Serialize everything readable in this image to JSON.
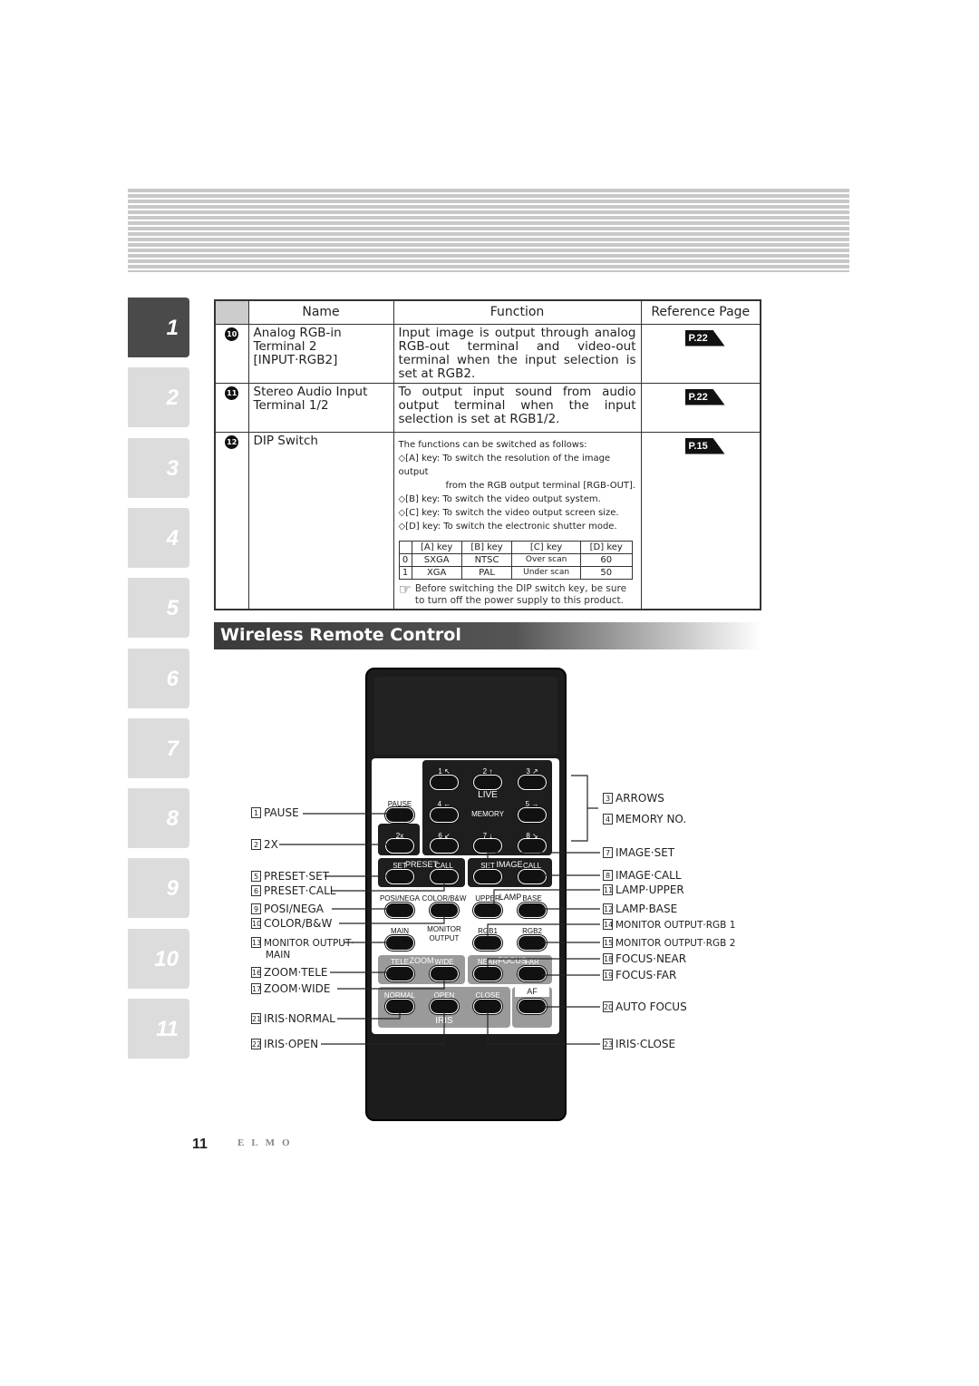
{
  "side_tabs": [
    "1",
    "2",
    "3",
    "4",
    "5",
    "6",
    "7",
    "8",
    "9",
    "10",
    "11"
  ],
  "active_tab": "1",
  "table": {
    "headers": [
      "",
      "Name",
      "Function",
      "Reference Page"
    ],
    "rows": [
      {
        "num": "10",
        "name": [
          "Analog RGB-in",
          "Terminal 2",
          "[INPUT·RGB2]"
        ],
        "function": "Input image is output through analog RGB-out terminal and video-out terminal when the input selection is set at RGB2.",
        "ref": "P.22"
      },
      {
        "num": "11",
        "name": [
          "Stereo Audio Input",
          "Terminal 1/2"
        ],
        "function": "To output input sound from audio output terminal when the input selection is set at RGB1/2.",
        "ref": "P.22"
      },
      {
        "num": "12",
        "name": [
          "DIP Switch"
        ],
        "ref": "P.15"
      }
    ],
    "dip": {
      "intro": "The functions can be switched as follows:",
      "keys": [
        {
          "key": "◇[A] key:",
          "text": "To switch the resolution of the image output",
          "text2": "from the RGB output terminal [RGB-OUT]."
        },
        {
          "key": "◇[B] key:",
          "text": "To switch the video output system."
        },
        {
          "key": "◇[C] key:",
          "text": "To switch the video output screen size."
        },
        {
          "key": "◇[D] key:",
          "text": "To switch the electronic shutter mode."
        }
      ],
      "switch_table": {
        "headers": [
          "",
          "[A] key",
          "[B] key",
          "[C] key",
          "[D] key"
        ],
        "rows": [
          [
            "0",
            "SXGA",
            "NTSC",
            "Over scan",
            "60"
          ],
          [
            "1",
            "XGA",
            "PAL",
            "Under scan",
            "50"
          ]
        ]
      },
      "note": "Before switching the DIP switch key, be sure to turn off the power supply to this product."
    }
  },
  "section_title": "Wireless Remote Control",
  "remote": {
    "panel_labels": {
      "live": "LIVE",
      "memory": "MEMORY",
      "preset": "PRESET",
      "image": "IMAGE",
      "lamp": "LAMP",
      "monitor": "MONITOR",
      "output": "OUTPUT",
      "zoom": "ZOOM",
      "focus": "FOCUS",
      "iris": "IRIS",
      "af": "AF"
    },
    "buttons": {
      "b1": "1 ↖",
      "b2": "2 ↑",
      "b3": "3 ↗",
      "pause": "PAUSE",
      "b4": "4 ←",
      "b5": "5 →",
      "x2": "2x",
      "b6": "6 ↙",
      "b7": "7 ↓",
      "b8": "8 ↘",
      "preset_set": "SET",
      "preset_call": "CALL",
      "image_set": "SET",
      "image_call": "CALL",
      "posi": "POSI/NEGA",
      "color": "COLOR/B&W",
      "upper": "UPPER",
      "base": "BASE",
      "main": "MAIN",
      "rgb1": "RGB1",
      "rgb2": "RGB2",
      "tele": "TELE",
      "wide": "WIDE",
      "near": "NEAR",
      "far": "FAR",
      "normal": "NORMAL",
      "open": "OPEN",
      "close": "CLOSE"
    },
    "left_callouts": [
      {
        "n": "1",
        "t": "PAUSE"
      },
      {
        "n": "2",
        "t": "2X"
      },
      {
        "n": "5",
        "t": "PRESET·SET"
      },
      {
        "n": "6",
        "t": "PRESET·CALL"
      },
      {
        "n": "9",
        "t": "POSI/NEGA"
      },
      {
        "n": "10",
        "t": "COLOR/B&W"
      },
      {
        "n": "13",
        "t": "MONITOR OUTPUT·",
        "t2": "MAIN"
      },
      {
        "n": "16",
        "t": "ZOOM·TELE"
      },
      {
        "n": "17",
        "t": "ZOOM·WIDE"
      },
      {
        "n": "21",
        "t": "IRIS·NORMAL"
      },
      {
        "n": "22",
        "t": "IRIS·OPEN"
      }
    ],
    "right_callouts": [
      {
        "n": "3",
        "t": "ARROWS"
      },
      {
        "n": "4",
        "t": "MEMORY NO."
      },
      {
        "n": "7",
        "t": "IMAGE·SET"
      },
      {
        "n": "8",
        "t": "IMAGE·CALL"
      },
      {
        "n": "11",
        "t": "LAMP·UPPER"
      },
      {
        "n": "12",
        "t": "LAMP·BASE"
      },
      {
        "n": "14",
        "t": "MONITOR OUTPUT·RGB 1"
      },
      {
        "n": "15",
        "t": "MONITOR OUTPUT·RGB 2"
      },
      {
        "n": "18",
        "t": "FOCUS·NEAR"
      },
      {
        "n": "19",
        "t": "FOCUS·FAR"
      },
      {
        "n": "20",
        "t": "AUTO FOCUS"
      },
      {
        "n": "23",
        "t": "IRIS·CLOSE"
      }
    ]
  },
  "footer": {
    "page_number": "11",
    "logo": "ELMO"
  }
}
